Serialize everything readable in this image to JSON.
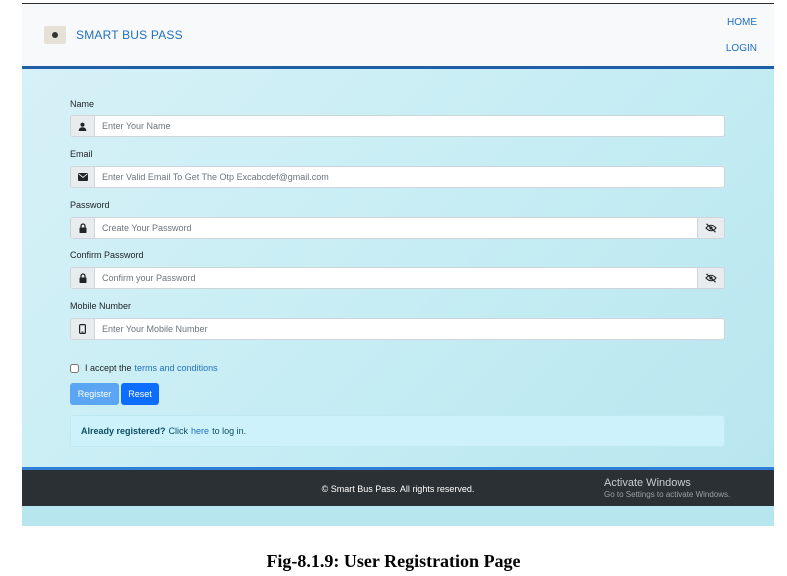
{
  "navbar": {
    "brand": "SMART BUS PASS",
    "links": [
      "HOME",
      "LOGIN"
    ]
  },
  "form": {
    "name": {
      "label": "Name",
      "placeholder": "Enter Your Name",
      "icon": "user-icon"
    },
    "email": {
      "label": "Email",
      "placeholder": "Enter Valid Email To Get The Otp Excabcdef@gmail.com",
      "icon": "envelope-icon"
    },
    "password": {
      "label": "Password",
      "placeholder": "Create Your Password",
      "icon": "lock-icon",
      "toggle_icon": "eye-slash-icon"
    },
    "confirm_password": {
      "label": "Confirm Password",
      "placeholder": "Confirm your Password",
      "icon": "lock-icon",
      "toggle_icon": "eye-slash-icon"
    },
    "mobile": {
      "label": "Mobile Number",
      "placeholder": "Enter Your Mobile Number",
      "icon": "mobile-icon"
    },
    "terms": {
      "prefix": "I accept the",
      "link": "terms and conditions",
      "checked": false
    },
    "register_label": "Register",
    "reset_label": "Reset"
  },
  "login_prompt": {
    "bold": "Already registered?",
    "pre": "Click",
    "link": "here",
    "post": "to log in."
  },
  "footer": {
    "copyright": "© Smart Bus Pass. All rights reserved.",
    "watermark_title": "Activate Windows",
    "watermark_sub": "Go to Settings to activate Windows."
  },
  "caption": "Fig-8.1.9: User Registration Page",
  "colors": {
    "brand": "#1f6fc0",
    "register_button": "#5aa6f2",
    "reset_button": "#0d6efd",
    "footer": "#2b3034",
    "background": "#c7edf4"
  }
}
